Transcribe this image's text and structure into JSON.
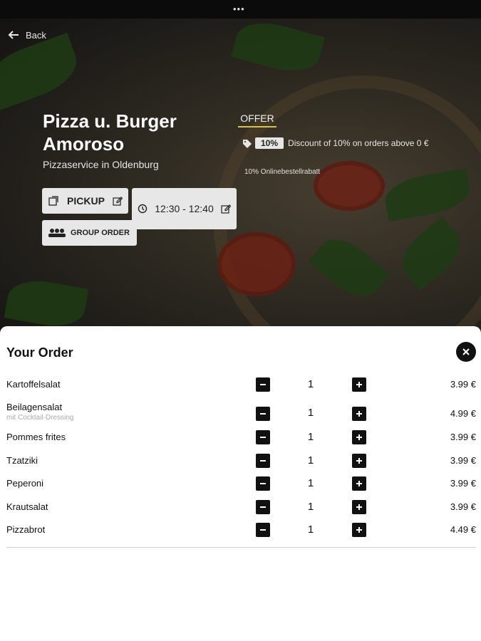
{
  "topbar": {
    "dots": "•••"
  },
  "hero": {
    "back_label": "Back",
    "title": "Pizza u. Burger Amoroso",
    "subtitle": "Pizzaservice in Oldenburg",
    "pickup_label": "PICKUP",
    "time_value": "12:30 - 12:40",
    "group_order_label": "GROUP ORDER",
    "offer_heading": "OFFER",
    "offer_percent": "10%",
    "offer_text": "Discount of 10% on orders above 0 €",
    "offer_subtext": "10% Onlinebestellrabatt"
  },
  "order": {
    "title": "Your Order",
    "items": [
      {
        "name": "Kartoffelsalat",
        "note": "",
        "qty": "1",
        "price": "3.99 €"
      },
      {
        "name": "Beilagensalat",
        "note": "mit Cocktail-Dressing",
        "qty": "1",
        "price": "4.99 €"
      },
      {
        "name": "Pommes frites",
        "note": "",
        "qty": "1",
        "price": "3.99 €"
      },
      {
        "name": "Tzatziki",
        "note": "",
        "qty": "1",
        "price": "3.99 €"
      },
      {
        "name": "Peperoni",
        "note": "",
        "qty": "1",
        "price": "3.99 €"
      },
      {
        "name": "Krautsalat",
        "note": "",
        "qty": "1",
        "price": "3.99 €"
      },
      {
        "name": "Pizzabrot",
        "note": "",
        "qty": "1",
        "price": "4.49 €"
      }
    ]
  },
  "colors": {
    "accent_underline": "#d8c436",
    "button_dark": "#111111",
    "chip_bg": "#e7e7e7"
  },
  "icons": [
    "back-arrow-icon",
    "edit-icon",
    "clock-icon",
    "group-icon",
    "tag-icon",
    "close-icon",
    "minus-icon",
    "plus-icon"
  ]
}
